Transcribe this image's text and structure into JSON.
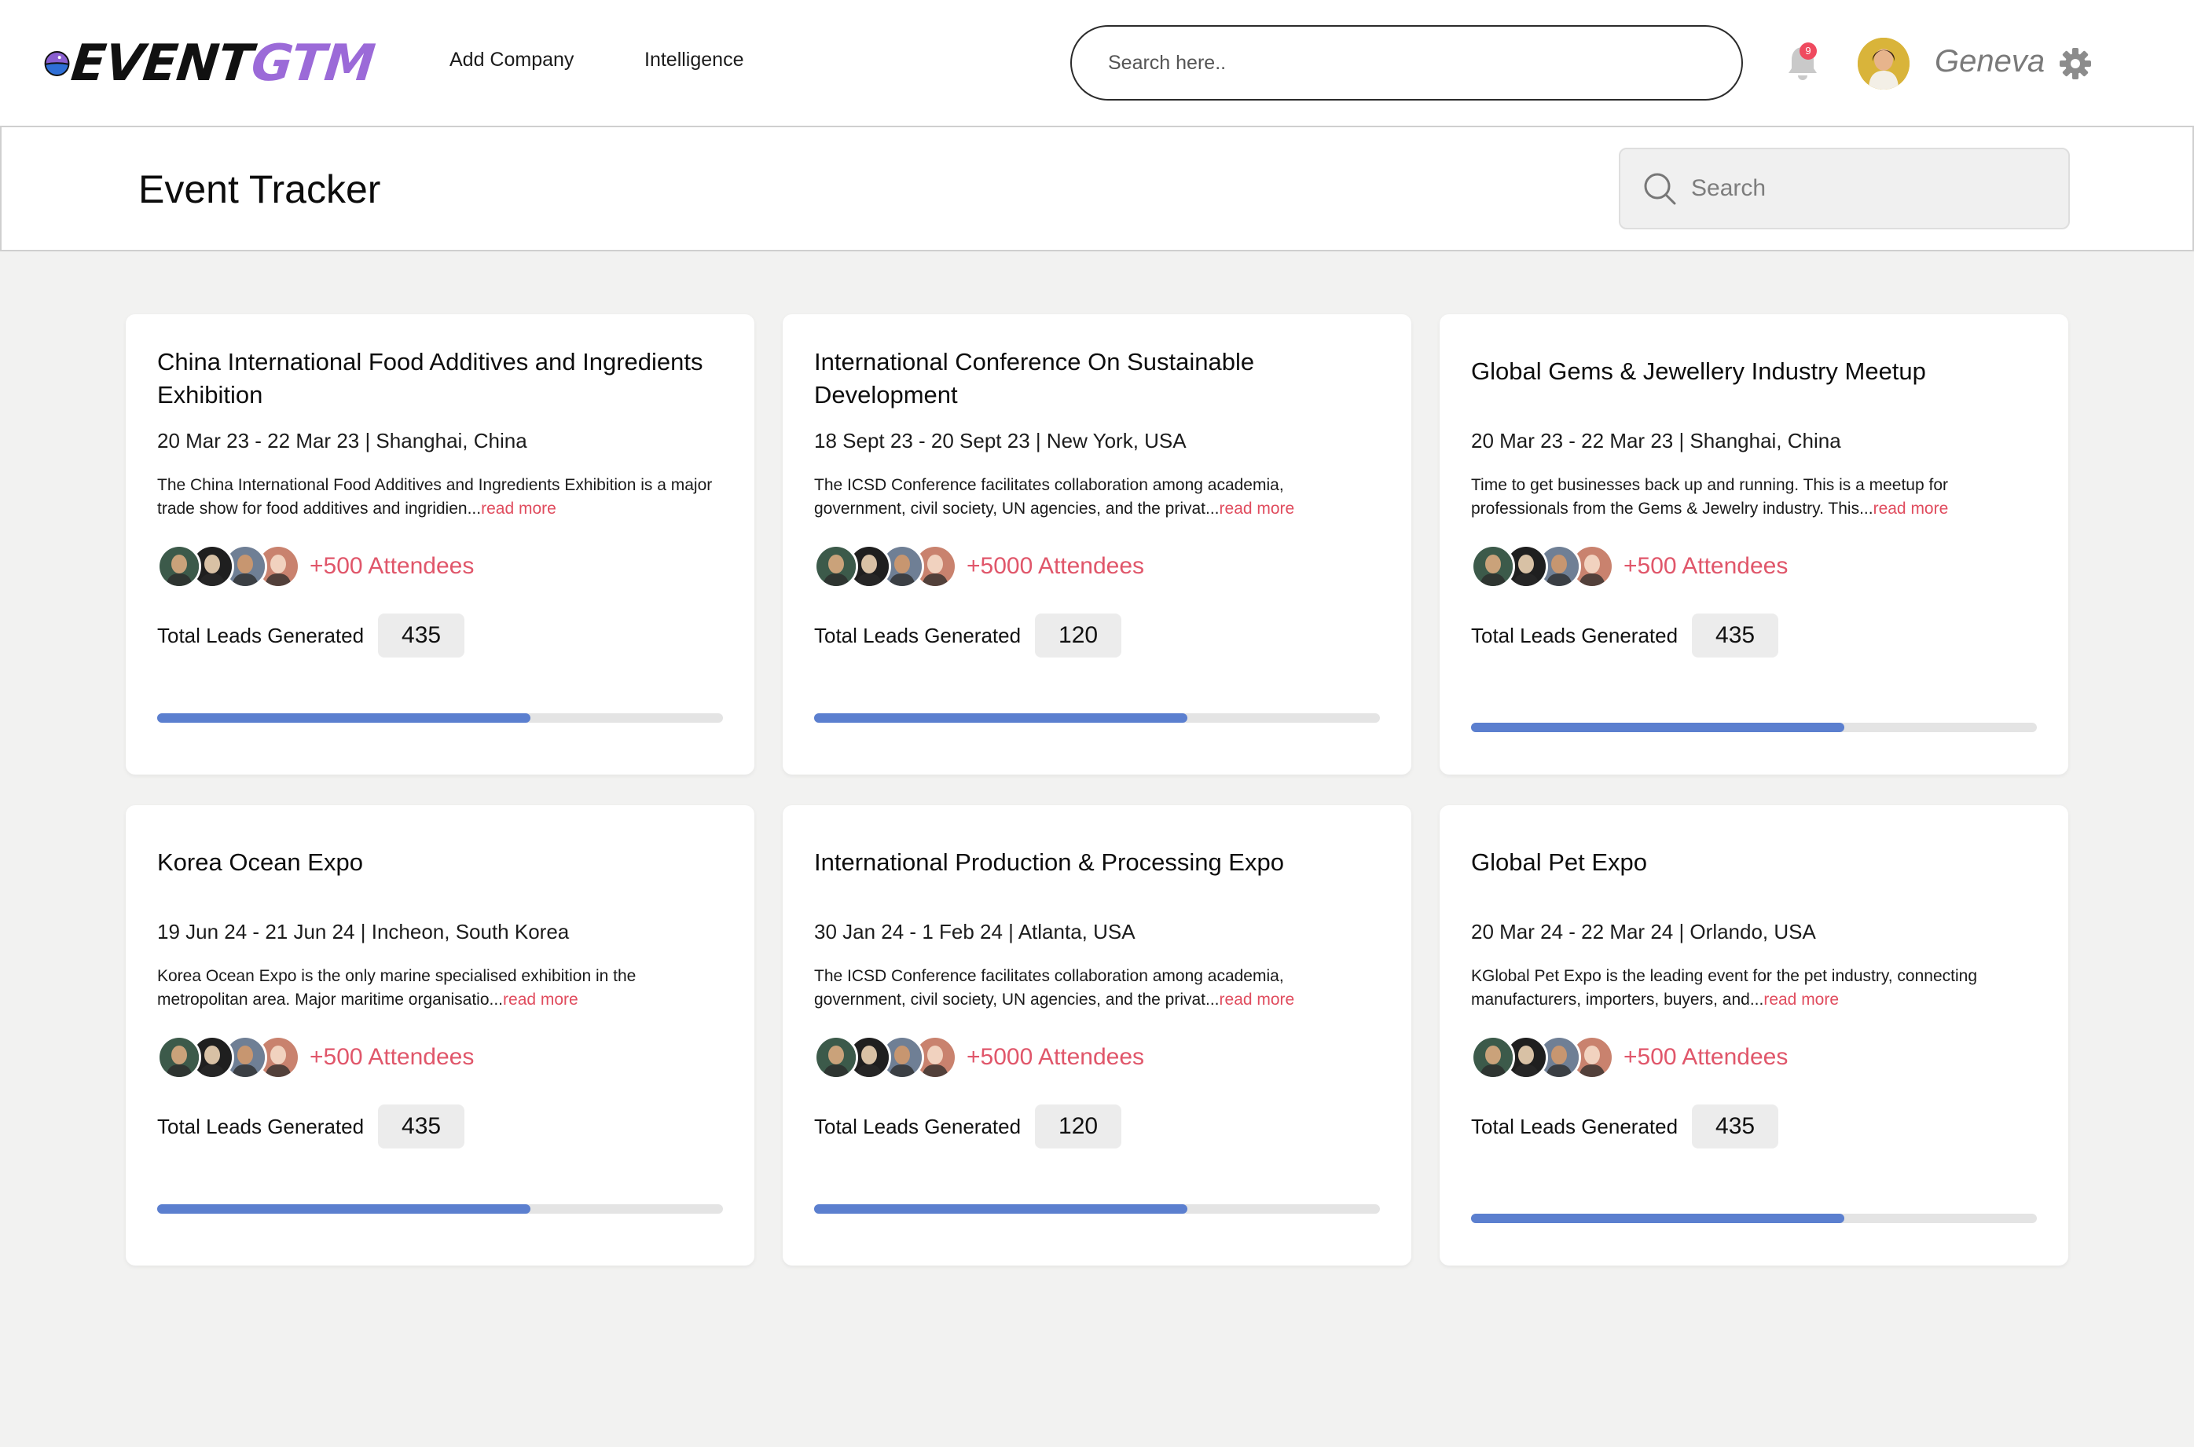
{
  "brand": {
    "name_a": "EVENT",
    "name_b": "GTM"
  },
  "nav": {
    "links": [
      "Add Company",
      "Intelligence"
    ]
  },
  "top_search": {
    "placeholder": "Search here.."
  },
  "notifications": {
    "count": "9"
  },
  "user": {
    "name": "Geneva"
  },
  "page": {
    "title": "Event Tracker",
    "search_placeholder": "Search"
  },
  "colors": {
    "accent": "#5b7fcf",
    "link": "#e04c5e",
    "brand_purple": "#9b6ad8"
  },
  "cards": [
    {
      "title": "China International Food Additives and Ingredients Exhibition",
      "meta": "20 Mar 23 - 22 Mar 23 | Shanghai, China",
      "desc": "The China International Food Additives and Ingredients Exhibition is a major trade show for food additives and ingridien...",
      "read_more": "read more",
      "attendees": "+500 Attendees",
      "leads_label": "Total Leads Generated",
      "leads_value": "435",
      "progress": 0.66
    },
    {
      "title": "International Conference On Sustainable Development",
      "meta": "18 Sept 23 - 20 Sept 23 | New York, USA",
      "desc": "The ICSD Conference facilitates collaboration among academia, government, civil society, UN agencies, and the privat...",
      "read_more": "read more",
      "attendees": "+5000 Attendees",
      "leads_label": "Total Leads Generated",
      "leads_value": "120",
      "progress": 0.66
    },
    {
      "title": "Global Gems & Jewellery Industry Meetup",
      "meta": "20 Mar 23 - 22 Mar 23 | Shanghai, China",
      "desc": "Time to get businesses back up and running. This is a meetup for professionals from the Gems & Jewelry industry. This...",
      "read_more": "read more",
      "attendees": "+500 Attendees",
      "leads_label": "Total Leads Generated",
      "leads_value": "435",
      "progress": 0.66
    },
    {
      "title": "Korea Ocean Expo",
      "meta": "19 Jun 24 - 21 Jun 24 | Incheon, South Korea",
      "desc": "Korea Ocean Expo is the only marine specialised exhibition in the metropolitan area. Major maritime organisatio...",
      "read_more": "read more",
      "attendees": "+500 Attendees",
      "leads_label": "Total Leads Generated",
      "leads_value": "435",
      "progress": 0.66
    },
    {
      "title": "International Production & Processing Expo",
      "meta": "30 Jan 24 - 1 Feb 24 | Atlanta, USA",
      "desc": "The ICSD Conference facilitates collaboration among academia, government, civil society, UN agencies, and the privat...",
      "read_more": "read more",
      "attendees": "+5000 Attendees",
      "leads_label": "Total Leads Generated",
      "leads_value": "120",
      "progress": 0.66
    },
    {
      "title": "Global Pet Expo",
      "meta": "20 Mar 24 - 22 Mar 24 | Orlando, USA",
      "desc": "KGlobal Pet Expo is the leading event for the pet industry, connecting manufacturers, importers, buyers, and...",
      "read_more": "read more",
      "attendees": "+500 Attendees",
      "leads_label": "Total Leads Generated",
      "leads_value": "435",
      "progress": 0.66
    }
  ]
}
